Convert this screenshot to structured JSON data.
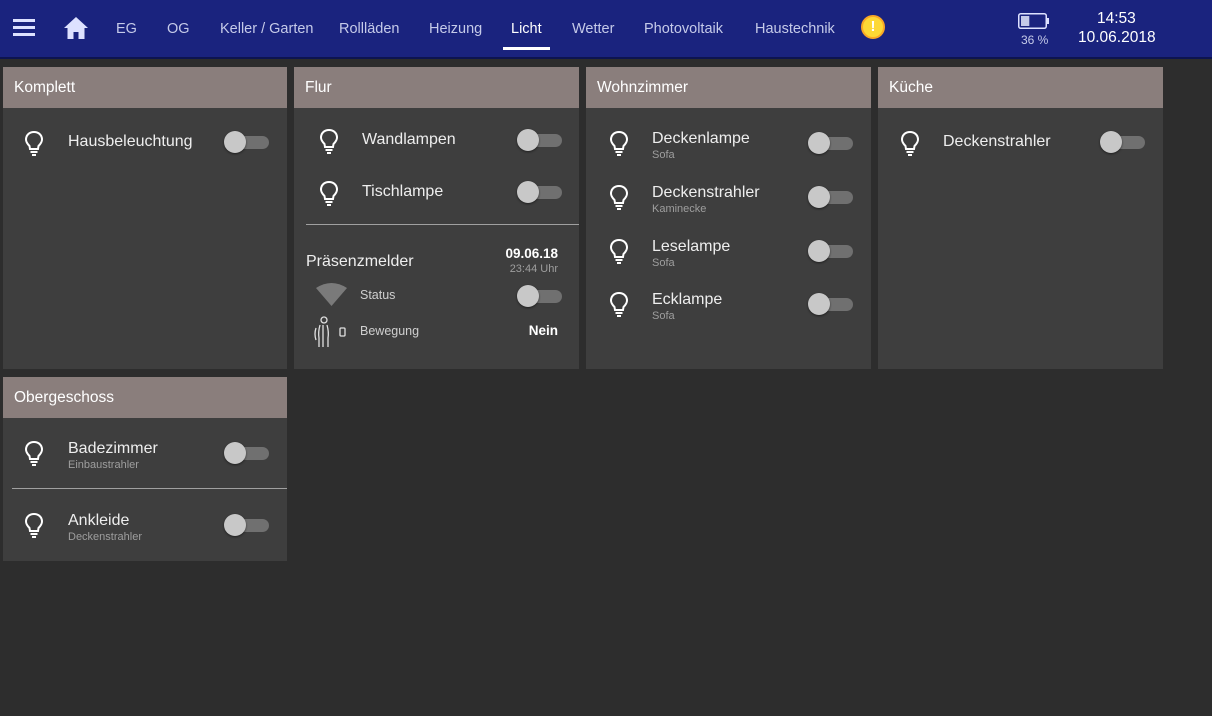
{
  "header": {
    "nav": [
      {
        "label": "EG"
      },
      {
        "label": "OG"
      },
      {
        "label": "Keller / Garten"
      },
      {
        "label": "Rollläden"
      },
      {
        "label": "Heizung"
      },
      {
        "label": "Licht"
      },
      {
        "label": "Wetter"
      },
      {
        "label": "Photovoltaik"
      },
      {
        "label": "Haustechnik"
      }
    ],
    "active_tab": "Licht",
    "alert_symbol": "!",
    "battery_percent": "36 %",
    "battery_level": 0.36,
    "time": "14:53",
    "date": "10.06.2018",
    "icons": {
      "menu": "hamburger-menu-icon",
      "home": "home-icon",
      "alert": "warning-icon",
      "battery": "battery-icon"
    }
  },
  "colors": {
    "topbar": "#1a237e",
    "background": "#2d2d2d",
    "card": "#3e3e3e",
    "card_header": "#8a7e7c",
    "alert": "#fdd835"
  },
  "cards": {
    "komplett": {
      "title": "Komplett",
      "items": [
        {
          "label": "Hausbeleuchtung",
          "state": false
        }
      ]
    },
    "flur": {
      "title": "Flur",
      "items": [
        {
          "label": "Wandlampen",
          "state": false
        },
        {
          "label": "Tischlampe",
          "state": false
        }
      ],
      "presence": {
        "title": "Präsenzmelder",
        "date": "09.06.18",
        "time": "23:44 Uhr",
        "status_label": "Status",
        "status_state": false,
        "motion_label": "Bewegung",
        "motion_value": "Nein"
      }
    },
    "wohnzimmer": {
      "title": "Wohnzimmer",
      "items": [
        {
          "label": "Deckenlampe",
          "sub": "Sofa",
          "state": false
        },
        {
          "label": "Deckenstrahler",
          "sub": "Kaminecke",
          "state": false
        },
        {
          "label": "Leselampe",
          "sub": "Sofa",
          "state": false
        },
        {
          "label": "Ecklampe",
          "sub": "Sofa",
          "state": false
        }
      ]
    },
    "kueche": {
      "title": "Küche",
      "items": [
        {
          "label": "Deckenstrahler",
          "state": false
        }
      ]
    },
    "obergeschoss": {
      "title": "Obergeschoss",
      "items": [
        {
          "label": "Badezimmer",
          "sub": "Einbaustrahler",
          "state": false
        },
        {
          "label": "Ankleide",
          "sub": "Deckenstrahler",
          "state": false
        }
      ]
    }
  }
}
